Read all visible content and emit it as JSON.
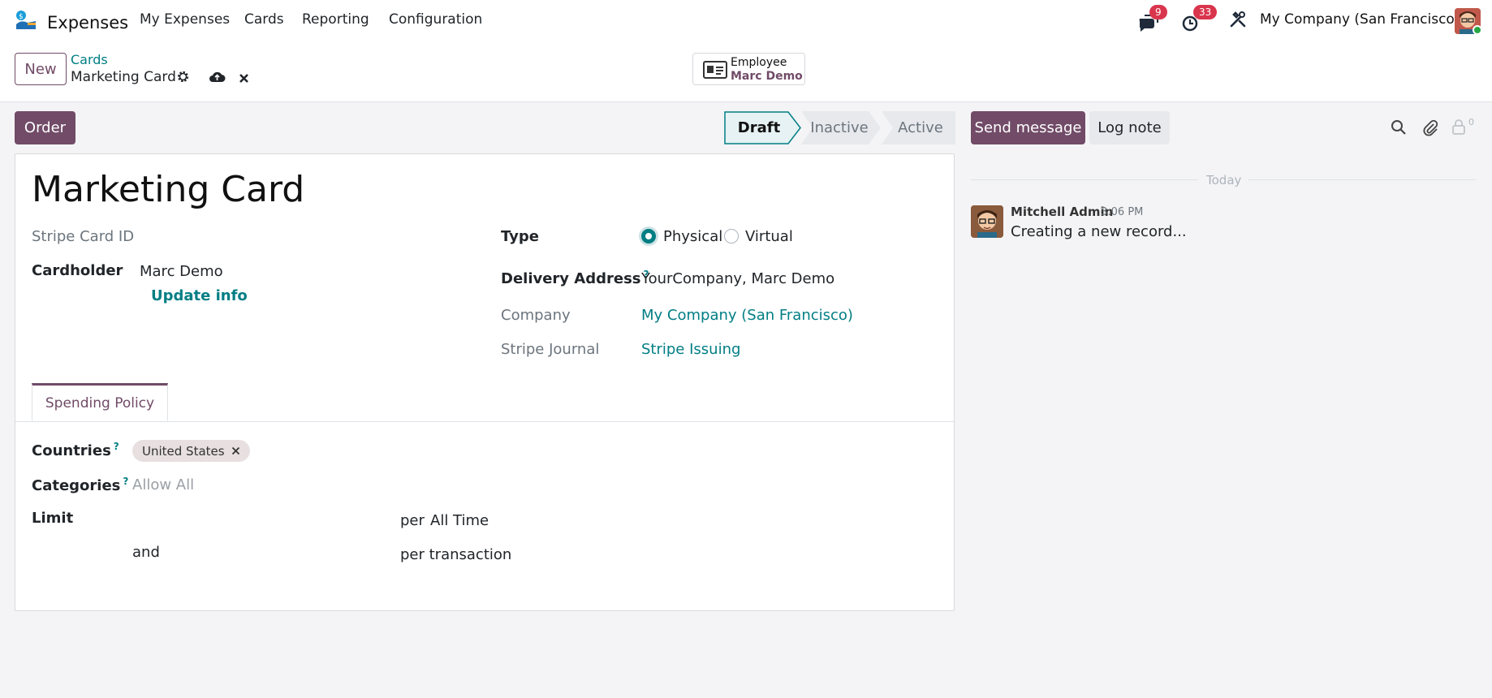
{
  "navbar": {
    "app_name": "Expenses",
    "menu": [
      "My Expenses",
      "Cards",
      "Reporting",
      "Configuration"
    ],
    "messages_count": "9",
    "activities_count": "33",
    "company": "My Company (San Francisco)"
  },
  "control": {
    "new_label": "New",
    "breadcrumb_parent": "Cards",
    "breadcrumb_current": "Marketing Card",
    "smart_button": {
      "label": "Employee",
      "value": "Marc Demo"
    }
  },
  "statusbar": {
    "order_label": "Order",
    "stages": [
      "Draft",
      "Inactive",
      "Active"
    ],
    "current_stage": "Draft"
  },
  "form": {
    "title": "Marketing Card",
    "stripe_card_id_label": "Stripe Card ID",
    "cardholder_label": "Cardholder",
    "cardholder_value": "Marc Demo",
    "update_info_label": "Update info",
    "type_label": "Type",
    "type_options": [
      "Physical",
      "Virtual"
    ],
    "type_selected": "Physical",
    "delivery_address_label": "Delivery Address",
    "delivery_address_value": "YourCompany, Marc Demo",
    "company_label": "Company",
    "company_value": "My Company (San Francisco)",
    "stripe_journal_label": "Stripe Journal",
    "stripe_journal_value": "Stripe Issuing",
    "help_marker": "?"
  },
  "tabs": {
    "spending_policy": "Spending Policy"
  },
  "policy": {
    "countries_label": "Countries",
    "countries_tags": [
      "United States"
    ],
    "categories_label": "Categories",
    "categories_placeholder": "Allow All",
    "limit_label": "Limit",
    "per_label": "per",
    "period_value": "All Time",
    "and_label": "and",
    "per_transaction_label": "per transaction"
  },
  "chatter": {
    "send_message_label": "Send message",
    "log_note_label": "Log note",
    "followers_count": "0",
    "today_label": "Today",
    "message": {
      "author": "Mitchell Admin",
      "time": "3:06 PM",
      "body": "Creating a new record..."
    }
  },
  "colors": {
    "primary": "#714B67",
    "link": "#017e84",
    "badge": "#d9354d"
  }
}
